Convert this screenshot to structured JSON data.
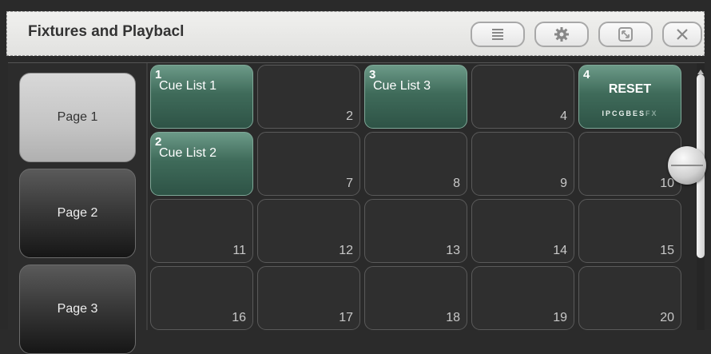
{
  "window": {
    "title": "Fixtures and Playbacl",
    "buttons": [
      {
        "name": "menu",
        "icon": "menu-icon"
      },
      {
        "name": "settings",
        "icon": "gear-icon"
      },
      {
        "name": "resize",
        "icon": "resize-icon"
      },
      {
        "name": "close",
        "icon": "close-icon"
      }
    ]
  },
  "sidebar": {
    "pages": [
      {
        "label": "Page 1",
        "active": true
      },
      {
        "label": "Page 2",
        "active": false
      },
      {
        "label": "Page 3",
        "active": false
      }
    ]
  },
  "grid": {
    "cells": [
      {
        "slot": "",
        "cue_number": "1",
        "cue_name": "Cue List 1"
      },
      {
        "slot": "2"
      },
      {
        "slot": "",
        "cue_number": "3",
        "cue_name": "Cue List 3"
      },
      {
        "slot": "4"
      },
      {
        "slot": "",
        "cue_number": "4",
        "cue_name": "RESET",
        "flags": "IPCGBES",
        "flags_dim": "FX"
      },
      {
        "slot": "",
        "cue_number": "2",
        "cue_name": "Cue List 2"
      },
      {
        "slot": "7"
      },
      {
        "slot": "8"
      },
      {
        "slot": "9"
      },
      {
        "slot": "10"
      },
      {
        "slot": "11"
      },
      {
        "slot": "12"
      },
      {
        "slot": "13"
      },
      {
        "slot": "14"
      },
      {
        "slot": "15"
      },
      {
        "slot": "16"
      },
      {
        "slot": "17"
      },
      {
        "slot": "18"
      },
      {
        "slot": "19"
      },
      {
        "slot": "20"
      }
    ]
  },
  "colors": {
    "cue_green": "#3f6b5a",
    "page_active": "#c4c4c4"
  }
}
